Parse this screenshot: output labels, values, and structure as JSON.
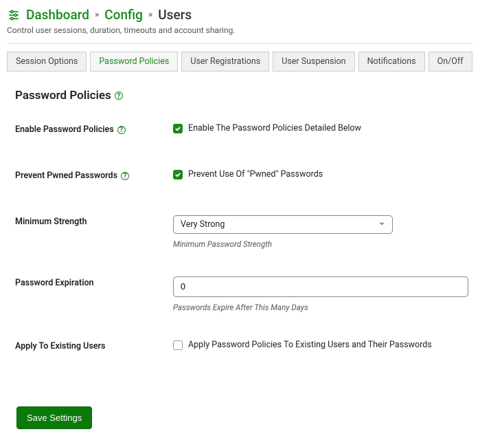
{
  "breadcrumb": {
    "dashboard": "Dashboard",
    "config": "Config",
    "current": "Users"
  },
  "subtitle": "Control user sessions, duration, timeouts and account sharing.",
  "tabs": [
    {
      "label": "Session Options",
      "active": false
    },
    {
      "label": "Password Policies",
      "active": true
    },
    {
      "label": "User Registrations",
      "active": false
    },
    {
      "label": "User Suspension",
      "active": false
    },
    {
      "label": "Notifications",
      "active": false
    },
    {
      "label": "On/Off",
      "active": false
    }
  ],
  "section_title": "Password Policies",
  "fields": {
    "enable": {
      "label": "Enable Password Policies",
      "checkbox_label": "Enable The Password Policies Detailed Below",
      "checked": true
    },
    "pwned": {
      "label": "Prevent Pwned Passwords",
      "checkbox_label": "Prevent Use Of \"Pwned\" Passwords",
      "checked": true
    },
    "strength": {
      "label": "Minimum Strength",
      "value": "Very Strong",
      "hint": "Minimum Password Strength"
    },
    "expiration": {
      "label": "Password Expiration",
      "value": "0",
      "hint": "Passwords Expire After This Many Days"
    },
    "apply": {
      "label": "Apply To Existing Users",
      "checkbox_label": "Apply Password Policies To Existing Users and Their Passwords",
      "checked": false
    }
  },
  "save_button": "Save Settings"
}
